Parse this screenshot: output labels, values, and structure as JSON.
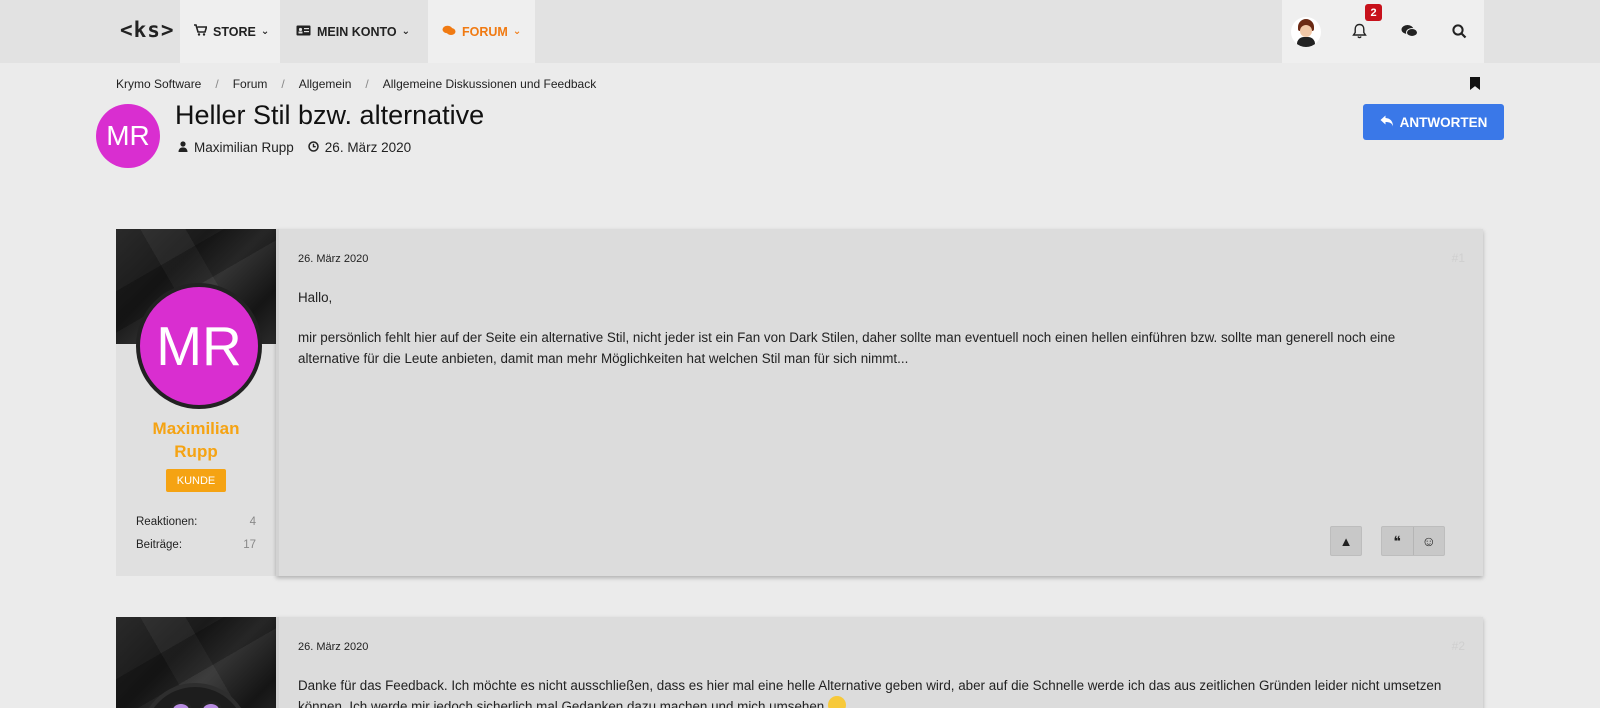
{
  "nav": {
    "logo": "<ks>",
    "store": "STORE",
    "konto": "MEIN KONTO",
    "forum": "FORUM",
    "notification_count": "2",
    "accent": "#f07a12"
  },
  "breadcrumb": [
    "Krymo Software",
    "Forum",
    "Allgemein",
    "Allgemeine Diskussionen und Feedback"
  ],
  "thread": {
    "avatar_initials": "MR",
    "title": "Heller Stil bzw. alternative",
    "author": "Maximilian Rupp",
    "date": "26. März 2020",
    "reply_label": "ANTWORTEN"
  },
  "posts": [
    {
      "avatar_initials": "MR",
      "username_line1": "Maximilian",
      "username_line2": "Rupp",
      "user_title": "KUNDE",
      "stat_reactions_label": "Reaktionen:",
      "stat_reactions_value": "4",
      "stat_posts_label": "Beiträge:",
      "stat_posts_value": "17",
      "date": "26. März 2020",
      "number": "#1",
      "paragraph1": "Hallo,",
      "paragraph2": "mir persönlich fehlt hier auf der Seite ein alternative Stil, nicht jeder ist ein Fan von Dark Stilen, daher sollte man eventuell noch einen hellen einführen bzw. sollte man generell noch eine alternative für die Leute anbieten, damit man mehr Möglichkeiten hat welchen Stil man für sich nimmt..."
    },
    {
      "date": "26. März 2020",
      "number": "#2",
      "paragraph1": "Danke für das Feedback. Ich möchte es nicht ausschließen, dass es hier mal eine helle Alternative geben wird, aber auf die Schnelle werde ich das aus zeitlichen Gründen leider nicht umsetzen können. Ich werde mir jedoch sicherlich mal Gedanken dazu machen und mich umsehen"
    }
  ],
  "icons": {
    "store": "shopping-cart-icon",
    "konto": "id-card-icon",
    "forum": "comments-icon",
    "bell": "bell-icon",
    "chat": "chat-icon",
    "search": "search-icon",
    "bookmark": "bookmark-icon",
    "user": "user-icon",
    "clock": "clock-icon",
    "reply": "reply-icon",
    "report": "warning-icon",
    "quote": "quote-icon",
    "react": "smiley-icon"
  },
  "colors": {
    "avatar": "#d92ed0",
    "username": "#f5a313",
    "button": "#3a78e8",
    "badge": "#c7111b"
  }
}
